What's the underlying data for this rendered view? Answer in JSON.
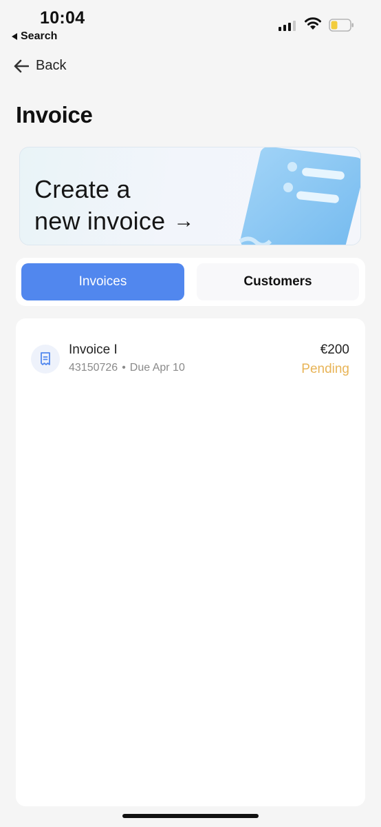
{
  "status_bar": {
    "time": "10:04",
    "back_app_label": "Search"
  },
  "nav": {
    "back_label": "Back"
  },
  "page": {
    "title": "Invoice"
  },
  "promo": {
    "line1": "Create a",
    "line2": "new invoice",
    "arrow": "→"
  },
  "tabs": [
    {
      "label": "Invoices",
      "active": true
    },
    {
      "label": "Customers",
      "active": false
    }
  ],
  "invoices": [
    {
      "title": "Invoice I",
      "number": "43150726",
      "separator": "•",
      "due": "Due Apr 10",
      "amount": "€200",
      "status": "Pending"
    }
  ],
  "colors": {
    "accent": "#5187ee",
    "pending": "#e8b457",
    "background": "#f5f5f5"
  },
  "icons": {
    "back": "arrow-left-icon",
    "invoice": "receipt-icon",
    "promo": "invoice-3d-illustration"
  }
}
